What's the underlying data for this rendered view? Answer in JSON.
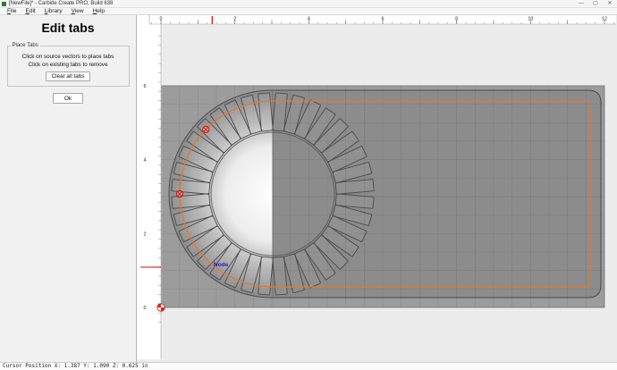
{
  "window": {
    "title": "[NewFile]* - Carbide Create PRO, Build 638",
    "minimize": "—",
    "maximize": "▢",
    "close": "✕"
  },
  "menu": {
    "items": [
      "File",
      "Edit",
      "Library",
      "View",
      "Help"
    ]
  },
  "sidebar": {
    "heading": "Edit tabs",
    "group": {
      "label": "Place Tabs",
      "instruction1": "Click on source vectors to place tabs",
      "instruction2": "Click on existing tabs to remove",
      "clear_button": "Clear all tabs"
    },
    "ok_button": "Ok"
  },
  "canvas": {
    "ruler": {
      "h_labels": [
        "0",
        "2",
        "4",
        "6",
        "8",
        "10",
        "12"
      ],
      "v_labels": [
        "0",
        "2",
        "4",
        "6"
      ],
      "cursor_x_in": 1.387,
      "cursor_y_in": 1.09,
      "units": "in"
    },
    "node_label": "Node",
    "tab_count": 36,
    "tab_markers_deg": [
      136,
      180
    ],
    "colors": {
      "canvas_bg": "#ececec",
      "stock": "#9c9c9c",
      "inner_shade": "rgba(0,0,0,0.10)",
      "vector": "#4a4a4a",
      "toolpath": "#e0792f",
      "marker_red": "#cc1111",
      "node_blue": "#1a1acc",
      "ruler_red": "#e02020"
    }
  },
  "statusbar": {
    "text": "Cursor Position X: 1.387 Y: 1.090 Z: 0.625 in"
  }
}
